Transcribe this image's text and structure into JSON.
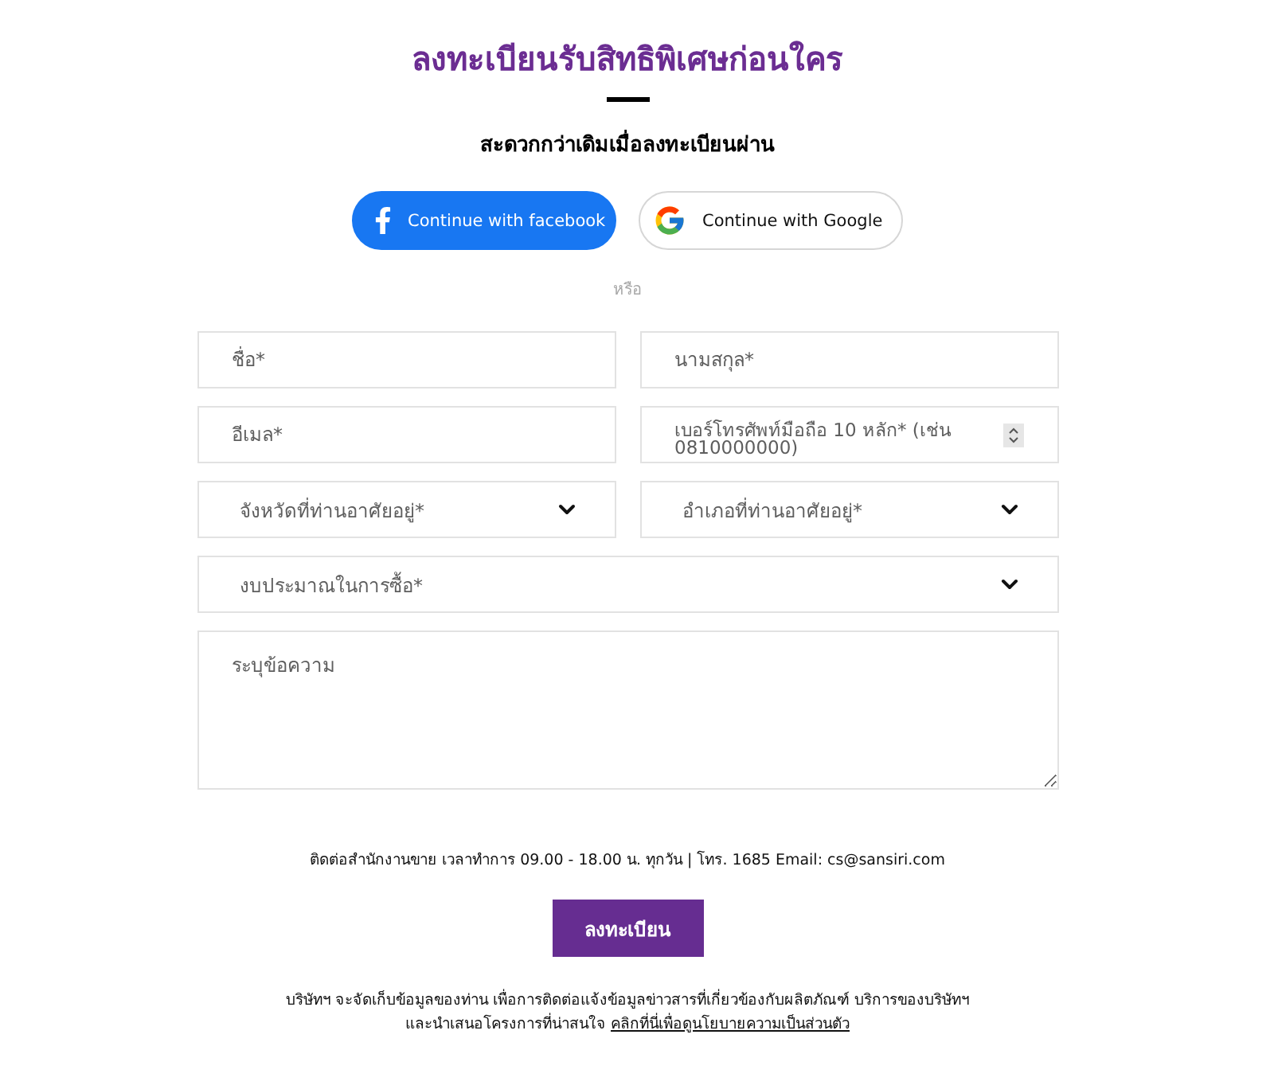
{
  "header": {
    "title": "ลงทะเบียนรับสิทธิพิเศษก่อนใคร",
    "subtitle": "สะดวกกว่าเดิมเมื่อลงทะเบียนผ่าน"
  },
  "social_buttons": [
    {
      "kind": "facebook",
      "label": "Continue with facebook"
    },
    {
      "kind": "google",
      "label": "Continue with Google"
    }
  ],
  "divider_text": "หรือ",
  "form": {
    "rows": [
      {
        "fields": [
          {
            "kind": "text",
            "placeholder": "ชื่อ*"
          },
          {
            "kind": "text",
            "placeholder": "นามสกุล*"
          }
        ]
      },
      {
        "fields": [
          {
            "kind": "text",
            "placeholder": "อีเมล*"
          },
          {
            "kind": "number",
            "placeholder": "เบอร์โทรศัพท์มือถือ 10 หลัก* (เช่น 0810000000)"
          }
        ]
      },
      {
        "fields": [
          {
            "kind": "select",
            "placeholder": "จังหวัดที่ท่านอาศัยอยู่*"
          },
          {
            "kind": "select",
            "placeholder": "อำเภอที่ท่านอาศัยอยู่*"
          }
        ]
      },
      {
        "fields": [
          {
            "kind": "select",
            "placeholder": "งบประมาณในการซื้อ*"
          }
        ]
      },
      {
        "fields": [
          {
            "kind": "textarea",
            "placeholder": "ระบุข้อความ"
          }
        ]
      }
    ]
  },
  "contact_text": "ติดต่อสำนักงานขาย เวลาทำการ 09.00 - 18.00 น. ทุกวัน | โทร. 1685 Email: cs@sansiri.com",
  "submit_button": "ลงทะเบียน",
  "consent": {
    "lines": [
      "บริษัทฯ จะจัดเก็บข้อมูลของท่าน เพื่อการติดต่อแจ้งข้อมูลข่าวสารที่เกี่ยวข้องกับผลิตภัณฑ์ บริการของบริษัทฯ",
      "และนำเสนอโครงการที่น่าสนใจ"
    ],
    "link": "คลิกที่นี่เพื่อดูนโยบายความเป็นส่วนตัว"
  }
}
